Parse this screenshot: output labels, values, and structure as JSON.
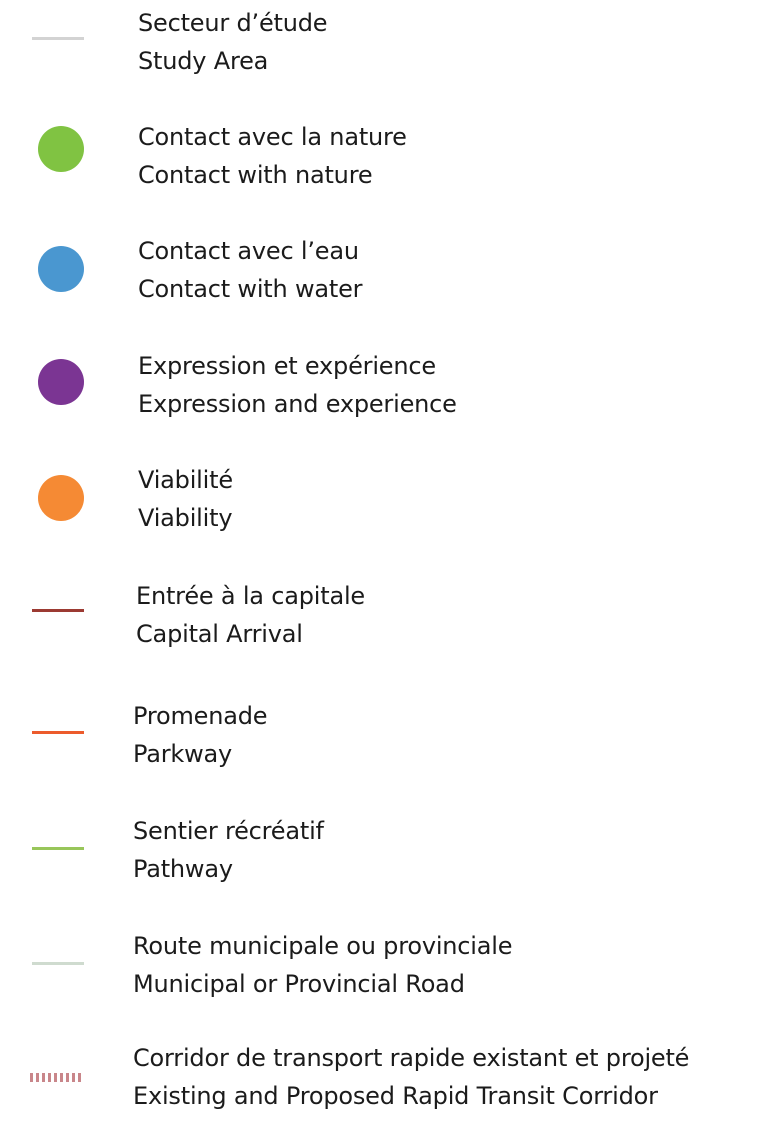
{
  "legend": {
    "items": [
      {
        "fr": "Secteur d’étude",
        "en": "Study Area",
        "symbol": "line",
        "color": "#d3d3d3"
      },
      {
        "fr": "Contact avec la nature",
        "en": "Contact with nature",
        "symbol": "dot",
        "color": "#80c342"
      },
      {
        "fr": "Contact avec l’eau",
        "en": "Contact with water",
        "symbol": "dot",
        "color": "#4a97d0"
      },
      {
        "fr": "Expression et expérience",
        "en": "Expression and experience",
        "symbol": "dot",
        "color": "#7b3593"
      },
      {
        "fr": "Viabilité",
        "en": "Viability",
        "symbol": "dot",
        "color": "#f58a34"
      },
      {
        "fr": "Entrée à la capitale",
        "en": "Capital Arrival",
        "symbol": "line",
        "color": "#9c3a32"
      },
      {
        "fr": "Promenade",
        "en": "Parkway",
        "symbol": "line",
        "color": "#ec5b2c"
      },
      {
        "fr": "Sentier récréatif",
        "en": "Pathway",
        "symbol": "line",
        "color": "#98c65a"
      },
      {
        "fr": "Route municipale ou provinciale",
        "en": "Municipal or Provincial Road",
        "symbol": "line",
        "color": "#cfdbcf"
      },
      {
        "fr": "Corridor de transport rapide existant et projeté",
        "en": "Existing and Proposed Rapid Transit Corridor",
        "symbol": "dashed",
        "color": "#c9868a"
      }
    ]
  }
}
